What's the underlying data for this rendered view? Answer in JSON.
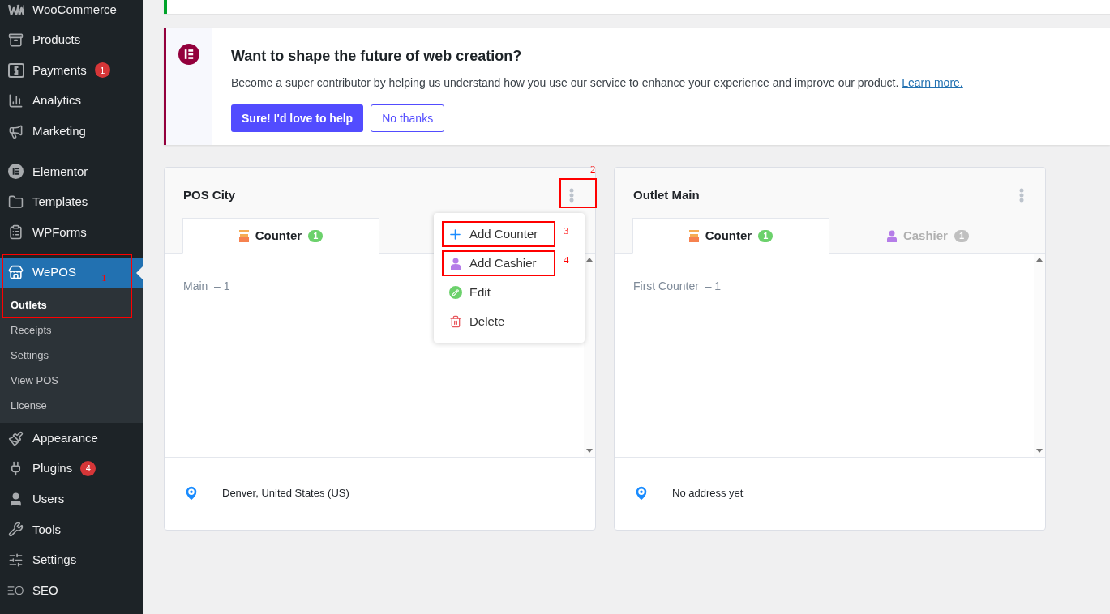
{
  "sidebar": {
    "items": [
      {
        "label": "WooCommerce",
        "selected": false
      },
      {
        "label": "Products",
        "selected": false
      },
      {
        "label": "Payments",
        "badge": "1",
        "selected": false
      },
      {
        "label": "Analytics",
        "selected": false
      },
      {
        "label": "Marketing",
        "selected": false
      },
      {
        "label": "Elementor",
        "selected": false
      },
      {
        "label": "Templates",
        "selected": false
      },
      {
        "label": "WPForms",
        "selected": false
      },
      {
        "label": "WePOS",
        "selected": true,
        "children": [
          {
            "label": "Outlets",
            "selected": true
          },
          {
            "label": "Receipts",
            "selected": false
          },
          {
            "label": "Settings",
            "selected": false
          },
          {
            "label": "View POS",
            "selected": false
          },
          {
            "label": "License",
            "selected": false
          }
        ]
      },
      {
        "label": "Appearance",
        "selected": false
      },
      {
        "label": "Plugins",
        "badge": "4",
        "selected": false
      },
      {
        "label": "Users",
        "selected": false
      },
      {
        "label": "Tools",
        "selected": false
      },
      {
        "label": "Settings",
        "selected": false
      },
      {
        "label": "SEO",
        "selected": false
      }
    ]
  },
  "notice": {
    "title": "Want to shape the future of web creation?",
    "text": "Become a super contributor by helping us understand how you use our service to enhance your experience and improve our product.",
    "link": "Learn more.",
    "primary_button": "Sure! I'd love to help",
    "secondary_button": "No thanks"
  },
  "outlets": [
    {
      "name": "POS City",
      "menu_open": true,
      "tabs": [
        {
          "label": "Counter",
          "count": "1",
          "kind": "counter",
          "selected": true
        }
      ],
      "items": [
        "Main  – 1"
      ],
      "address": "Denver, United States (US)"
    },
    {
      "name": "Outlet Main",
      "menu_open": false,
      "tabs": [
        {
          "label": "Counter",
          "count": "1",
          "kind": "counter",
          "selected": true
        },
        {
          "label": "Cashier",
          "count": "1",
          "kind": "cashier",
          "selected": false
        }
      ],
      "items": [
        "First Counter  – 1"
      ],
      "address": "No address yet"
    }
  ],
  "menu": [
    {
      "label": "Add Counter",
      "kind": "add"
    },
    {
      "label": "Add Cashier",
      "kind": "cashier"
    },
    {
      "label": "Edit",
      "kind": "edit"
    },
    {
      "label": "Delete",
      "kind": "delete"
    }
  ],
  "annotations": [
    "1",
    "2",
    "3",
    "4"
  ]
}
